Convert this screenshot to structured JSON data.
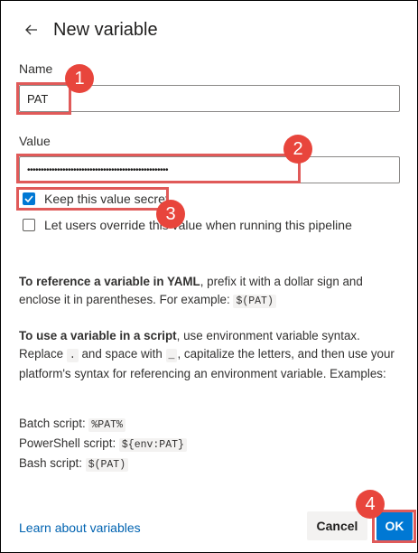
{
  "header": {
    "title": "New variable"
  },
  "name_field": {
    "label": "Name",
    "value": "PAT"
  },
  "value_field": {
    "label": "Value",
    "value": "••••••••••••••••••••••••••••••••••••••••••••••••••••"
  },
  "options": {
    "keep_secret": {
      "label": "Keep this value secret",
      "checked": true
    },
    "allow_override": {
      "label": "Let users override this value when running this pipeline",
      "checked": false
    }
  },
  "help": {
    "yaml_bold": "To reference a variable in YAML",
    "yaml_text_1": ", prefix it with a dollar sign and enclose it in parentheses. For example: ",
    "yaml_code": "$(PAT)",
    "script_bold": "To use a variable in a script",
    "script_text_1": ", use environment variable syntax. Replace ",
    "script_code_dot": ".",
    "script_text_2": " and space with ",
    "script_code_underscore": "_",
    "script_text_3": ", capitalize the letters, and then use your platform's syntax for referencing an environment variable. Examples:",
    "batch_label": "Batch script: ",
    "batch_code": "%PAT%",
    "ps_label": "PowerShell script: ",
    "ps_code": "${env:PAT}",
    "bash_label": "Bash script: ",
    "bash_code": "$(PAT)"
  },
  "footer": {
    "learn_link": "Learn about variables",
    "cancel_label": "Cancel",
    "ok_label": "OK"
  },
  "annotations": [
    "1",
    "2",
    "3",
    "4"
  ],
  "colors": {
    "accent": "#0078d4",
    "annotation": "#e8453c"
  }
}
